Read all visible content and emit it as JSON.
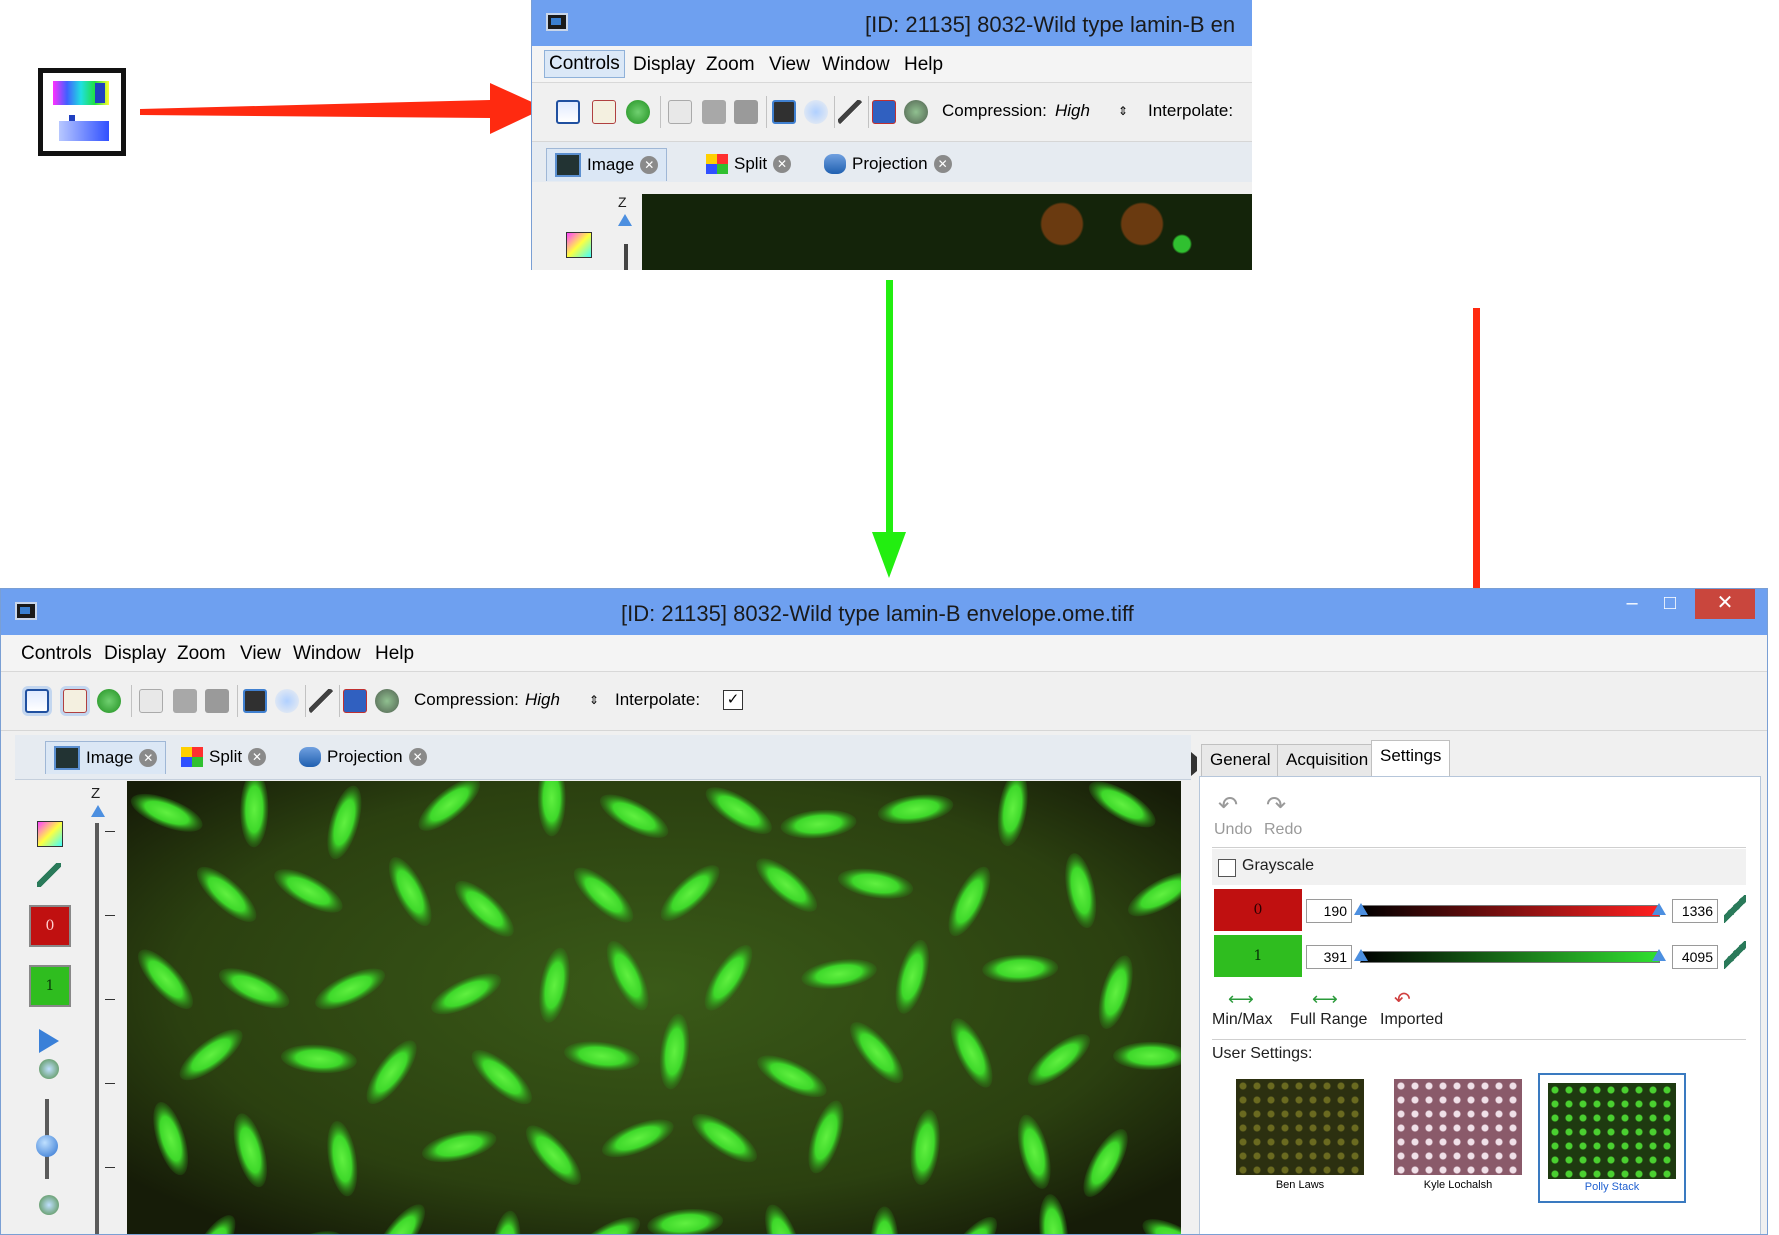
{
  "colors": {
    "red_arrow": "#ff2a10",
    "green_arrow": "#22ee10",
    "titlebar": "#6ea0f0",
    "channel_red": "#c01010",
    "channel_green": "#2fbd1f",
    "slider_blue": "#4c8fe0"
  },
  "top_window": {
    "title": "[ID: 21135] 8032-Wild type lamin-B en",
    "menu": [
      "Controls",
      "Display",
      "Zoom",
      "View",
      "Window",
      "Help"
    ],
    "toolbar": {
      "compression_label": "Compression:",
      "compression_value": "High",
      "interpolate_label": "Interpolate:"
    },
    "tabs": [
      "Image",
      "Split",
      "Projection"
    ],
    "z_label": "Z"
  },
  "main_window": {
    "title": "[ID: 21135] 8032-Wild type lamin-B envelope.ome.tiff",
    "window_controls": [
      "–",
      "□",
      "✕"
    ],
    "menu": [
      "Controls",
      "Display",
      "Zoom",
      "View",
      "Window",
      "Help"
    ],
    "toolbar": {
      "compression_label": "Compression:",
      "compression_value": "High",
      "interpolate_label": "Interpolate:",
      "interpolate_checked": true
    },
    "tabs": [
      "Image",
      "Split",
      "Projection"
    ],
    "z_label": "Z",
    "channel_buttons": [
      "0",
      "1"
    ],
    "right_tabs": [
      "General",
      "Acquisition",
      "Settings"
    ],
    "settings": {
      "undo_label": "Undo",
      "redo_label": "Redo",
      "grayscale_label": "Grayscale",
      "grayscale_checked": false,
      "channels": [
        {
          "name": "0",
          "min": "190",
          "max": "1336",
          "color": "#c01010"
        },
        {
          "name": "1",
          "min": "391",
          "max": "4095",
          "color": "#2fbd1f"
        }
      ],
      "actions": [
        "Min/Max",
        "Full Range",
        "Imported"
      ],
      "user_settings_label": "User Settings:",
      "user_settings": [
        "Ben Laws",
        "Kyle Lochalsh",
        "Polly Stack"
      ]
    }
  }
}
